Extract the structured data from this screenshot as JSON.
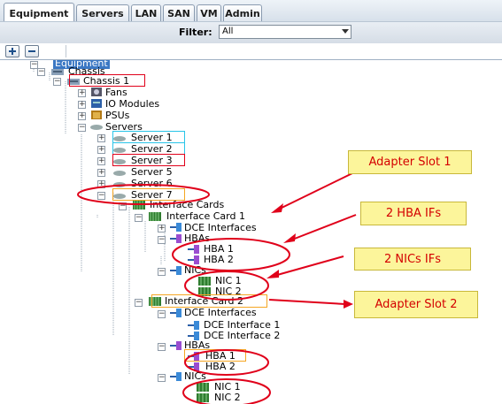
{
  "tabs": [
    "Equipment",
    "Servers",
    "LAN",
    "SAN",
    "VM",
    "Admin"
  ],
  "filter": {
    "label": "Filter:",
    "value": "All"
  },
  "tree": {
    "root": "Equipment",
    "chassis": "Chassis",
    "chassis1": "Chassis 1",
    "fans": "Fans",
    "io": "IO Modules",
    "psus": "PSUs",
    "servers": "Servers",
    "server1": "Server 1",
    "server2": "Server 2",
    "server3": "Server 3",
    "server5": "Server 5",
    "server6": "Server 6",
    "server7": "Server 7",
    "interfaceCards": "Interface Cards",
    "ic1": "Interface Card 1",
    "dce": "DCE Interfaces",
    "hbas": "HBAs",
    "hba1": "HBA 1",
    "hba2": "HBA 2",
    "nics": "NICs",
    "nic1": "NIC 1",
    "nic2": "NIC 2",
    "ic2": "Interface Card 2",
    "dce2": "DCE Interfaces",
    "dceIf1": "DCE Interface 1",
    "dceIf2": "DCE Interface 2",
    "hbas2": "HBAs",
    "hba21": "HBA 1",
    "hba22": "HBA 2",
    "nics2": "NICs",
    "nic21": "NIC 1",
    "nic22": "NIC 2"
  },
  "annotations": {
    "slot1": "Adapter Slot 1",
    "hbaIfs": "2 HBA IFs",
    "nicIfs": "2 NICs IFs",
    "slot2": "Adapter Slot 2"
  },
  "colors": {
    "callout_bg": "#fcf59b",
    "callout_text": "#d40000",
    "red": "#e0001a",
    "cyan": "#29c4e8",
    "orange": "#f5a623"
  }
}
